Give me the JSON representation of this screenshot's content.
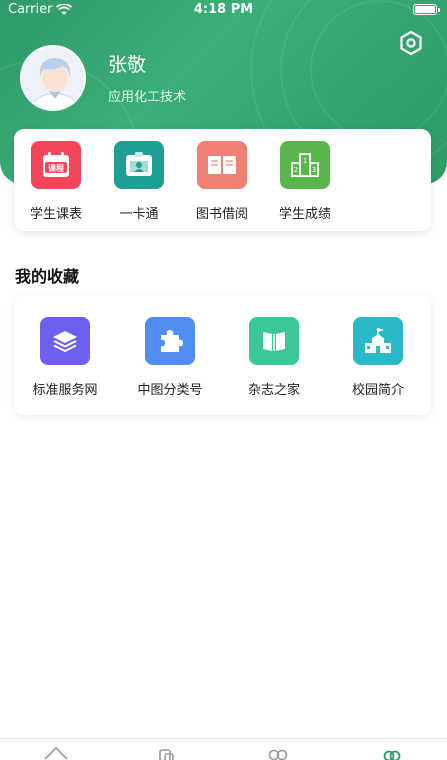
{
  "status_bar": {
    "carrier": "Carrier",
    "time": "4:18 PM"
  },
  "profile": {
    "name": "张敬",
    "major": "应用化工技术"
  },
  "quick_actions": [
    {
      "label": "学生课表",
      "icon": "course-schedule-icon",
      "tile_text": "课程",
      "color": "#f2465a"
    },
    {
      "label": "一卡通",
      "icon": "id-card-icon",
      "color": "#1f9e93"
    },
    {
      "label": "图书借阅",
      "icon": "book-icon",
      "color": "#f07f74"
    },
    {
      "label": "学生成绩",
      "icon": "podium-icon",
      "color": "#5ab64c"
    }
  ],
  "favorites": {
    "title": "我的收藏",
    "items": [
      {
        "label": "标准服务网",
        "icon": "layers-icon",
        "color": "#6d60f0"
      },
      {
        "label": "中图分类号",
        "icon": "puzzle-icon",
        "color": "#4f8ef0"
      },
      {
        "label": "杂志之家",
        "icon": "open-book-icon",
        "color": "#3cc896"
      },
      {
        "label": "校园简介",
        "icon": "school-building-icon",
        "color": "#2bb8c8"
      }
    ]
  },
  "tab_bar": {
    "tabs": [
      {
        "icon": "home-icon"
      },
      {
        "icon": "apps-icon"
      },
      {
        "icon": "messages-icon"
      },
      {
        "icon": "profile-icon",
        "active": true
      }
    ]
  },
  "colors": {
    "header_green": "#34a56f",
    "active_tab": "#2f9a68"
  }
}
